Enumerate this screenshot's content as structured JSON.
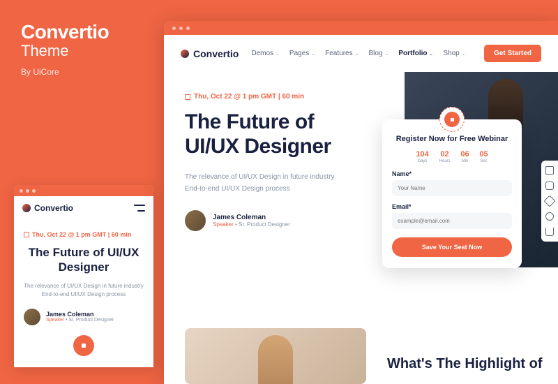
{
  "sidebar": {
    "title": "Convertio",
    "subtitle": "Theme",
    "author": "By UiCore"
  },
  "brand": "Convertio",
  "nav": {
    "items": [
      "Demos",
      "Pages",
      "Features",
      "Blog",
      "Portfolio",
      "Shop"
    ],
    "active": "Portfolio"
  },
  "cta": "Get Started",
  "event": {
    "date": "Thu, Oct 22 @ 1 pm GMT | 60 min",
    "heading": "The Future of UI/UX Designer",
    "desc": "The relevance of UI/UX Design in future industry End-to-end UI/UX Design process"
  },
  "author": {
    "name": "James Coleman",
    "speaker": "Speaker",
    "role": "Sr. Product Designer"
  },
  "webinar": {
    "title": "Register Now for Free Webinar",
    "countdown": [
      {
        "n": "104",
        "l": "Days"
      },
      {
        "n": "02",
        "l": "Hours"
      },
      {
        "n": "06",
        "l": "Min"
      },
      {
        "n": "05",
        "l": "Sec"
      }
    ],
    "name_label": "Name*",
    "name_ph": "Your Name",
    "email_label": "Email*",
    "email_ph": "example@email.com",
    "submit": "Save Your Seat Now"
  },
  "highlight": "What's The Highlight of"
}
